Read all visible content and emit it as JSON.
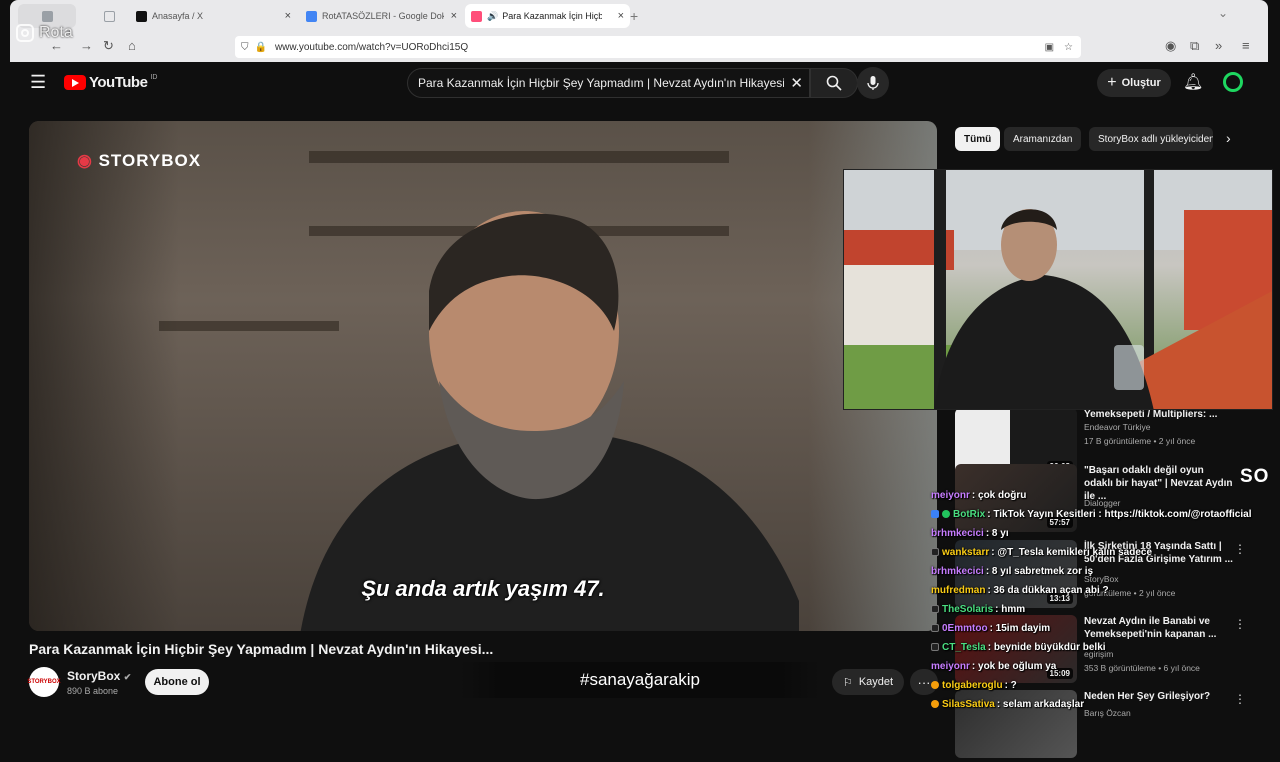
{
  "browser": {
    "tabs": [
      {
        "label": "",
        "color": "#9aa0a6"
      },
      {
        "label": "",
        "color": "#9aa0a6"
      },
      {
        "label": "Anasayfa / X",
        "color": "#111111"
      },
      {
        "label": "RotATASÖZLERI - Google Dokür",
        "color": "#4285f4"
      },
      {
        "label": "Para Kazanmak İçin Hiçbir Ş",
        "color": "#ff4e7a"
      }
    ],
    "url": "www.youtube.com/watch?v=UORoDhci15Q"
  },
  "youtube": {
    "logo": "YouTube",
    "region": "ID",
    "search_value": "Para Kazanmak İçin Hiçbir Şey Yapmadım | Nevzat Aydın'ın Hikayesi...",
    "create_label": "Oluştur"
  },
  "video": {
    "brand_logo": "STORYBOX",
    "subtitle": "Şu anda artık yaşım 47.",
    "title": "Para Kazanmak İçin Hiçbir Şey Yapmadım | Nevzat Aydın'ın Hikayesi...",
    "channel": "StoryBox",
    "channel_avatar": "STORYBOX",
    "subscribers": "890 B abone",
    "subscribe_label": "Abone ol",
    "save_label": "Kaydet",
    "more_label": "···",
    "hashtag": "#sanayağarakip"
  },
  "chips": [
    "Tümü",
    "Aramanızdan",
    "StoryBox adlı yükleyiciden"
  ],
  "recommendations": [
    {
      "title": "Yemeksepeti / Multipliers: ...",
      "channel": "Endeavor Türkiye",
      "meta": "17 B görüntüleme • 2 yıl önce",
      "duration": "26:08"
    },
    {
      "title": "\"Başarı odaklı değil oyun odaklı bir hayat\" | Nevzat Aydın ile ...",
      "channel": "Dialogger",
      "meta": "",
      "duration": "57:57"
    },
    {
      "title": "İlk Şirketini 18 Yaşında Sattı | 50'den Fazla Girişime Yatırım ...",
      "channel": "StoryBox",
      "meta": "görüntüleme • 2 yıl önce",
      "duration": "13:13"
    },
    {
      "title": "Nevzat Aydın ile Banabi ve Yemeksepeti'nin kapanan ...",
      "channel": "egirişim",
      "meta": "353 B görüntüleme • 6 yıl önce",
      "duration": "15:09"
    },
    {
      "title": "Neden Her Şey Grileşiyor?",
      "channel": "Barış Özcan",
      "meta": "",
      "duration": ""
    }
  ],
  "chat": [
    {
      "user": "meiyonr",
      "msg": ": çok doğru",
      "color": "#c77dff"
    },
    {
      "user": "BotRix",
      "msg": ": TikTok Yayın Kesitleri : https://tiktok.com/@rotaofficial",
      "color": "#4ade80"
    },
    {
      "user": "brhmkecici",
      "msg": ": 8 yı",
      "color": "#c77dff"
    },
    {
      "user": "wankstarr",
      "msg": ": @T_Tesla kemikleri kalın sadece",
      "color": "#facc15"
    },
    {
      "user": "brhmkecici",
      "msg": ": 8 yıl sabretmek zor iş",
      "color": "#c77dff"
    },
    {
      "user": "mufredman",
      "msg": ": 36 da dükkan açan abi ?",
      "color": "#facc15"
    },
    {
      "user": "TheSolaris",
      "msg": ": hmm",
      "color": "#4ade80"
    },
    {
      "user": "0Emmtoo",
      "msg": ": 15im dayim",
      "color": "#c77dff"
    },
    {
      "user": "CT_Tesla",
      "msg": ": beynide büyükdür belki",
      "color": "#4ade80"
    },
    {
      "user": "meiyonr",
      "msg": ": yok be oğlum ya",
      "color": "#c77dff"
    },
    {
      "user": "tolgaberoglu",
      "msg": ": ?",
      "color": "#facc15"
    },
    {
      "user": "SilasSativa",
      "msg": ": selam arkadaşlar",
      "color": "#facc15"
    }
  ],
  "overlay": {
    "watermark": "Rota",
    "so": "SO"
  }
}
